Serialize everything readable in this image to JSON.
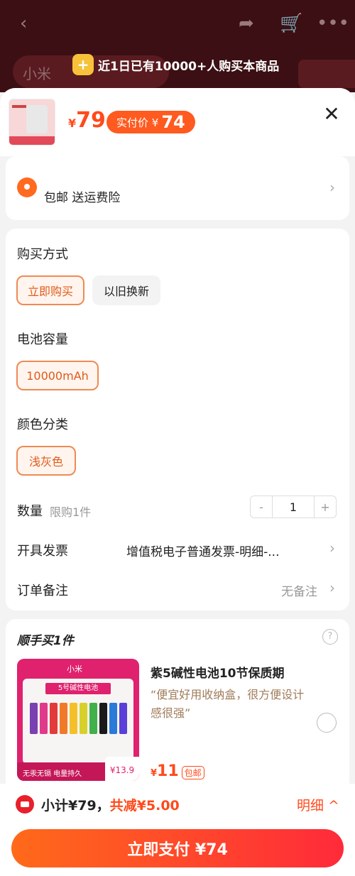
{
  "promo_banner": {
    "text": "近1日已有10000+人购买本商品"
  },
  "background_shop": {
    "name": "小米"
  },
  "header": {
    "currency": "¥",
    "price": "79",
    "pay_tag_label": "实付价 ¥",
    "pay_tag_value": "74",
    "close_label": "✕"
  },
  "address": {
    "text": "包邮  送运费险"
  },
  "options": {
    "purchase_method": {
      "label": "购买方式",
      "choices": [
        "立即购买",
        "以旧换新"
      ],
      "selected": "立即购买"
    },
    "battery_capacity": {
      "label": "电池容量",
      "choices": [
        "10000mAh"
      ],
      "selected": "10000mAh"
    },
    "color": {
      "label": "颜色分类",
      "choices": [
        "浅灰色"
      ],
      "selected": "浅灰色"
    },
    "quantity": {
      "label": "数量",
      "limit": "限购1件",
      "value": "1",
      "minus": "-",
      "plus": "+"
    },
    "invoice": {
      "label": "开具发票",
      "value": "增值税电子普通发票-明细-..."
    },
    "note": {
      "label": "订单备注",
      "value": "无备注"
    }
  },
  "addon": {
    "title": "顺手买1件",
    "help": "?",
    "product_name": "紫5碱性电池10节保质期",
    "description": "“便宜好用收纳盒，很方便设计感很强”",
    "currency": "¥",
    "price": "11",
    "badge": "包邮",
    "image_brand": "小米",
    "image_label": "5号碱性电池",
    "image_footer": "无汞无镉  电量持久",
    "image_price": "¥13.9"
  },
  "footer": {
    "subtotal": "小计¥79，",
    "discount": "共减¥5.00",
    "detail": "明细 ^",
    "pay_button": "立即支付 ¥74"
  },
  "colors": {
    "accent": "#ff4a1b",
    "brand_pink": "#e0216e"
  }
}
